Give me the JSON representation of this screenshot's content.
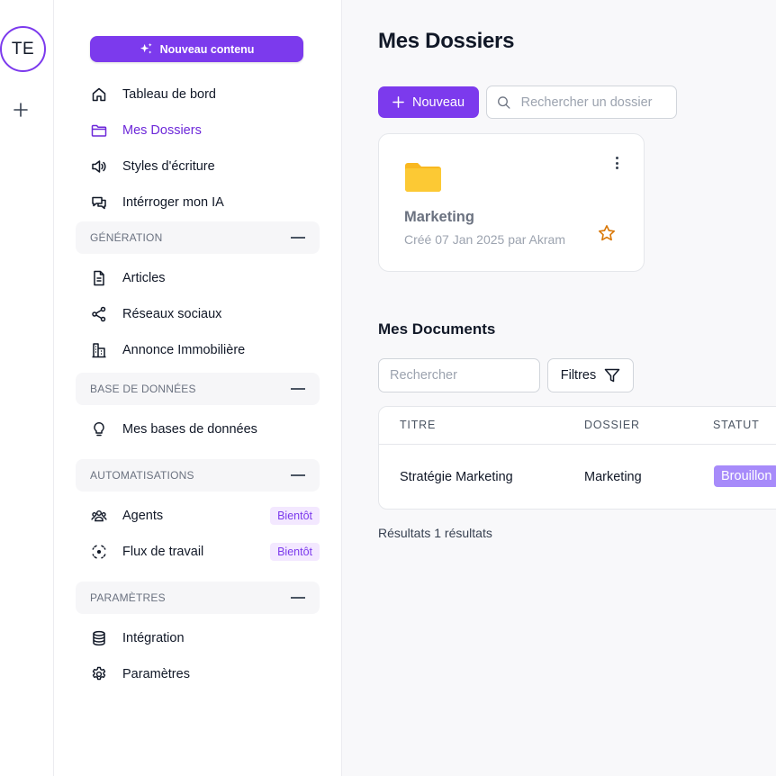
{
  "rail": {
    "avatar_initials": "TE"
  },
  "sidebar": {
    "new_content_label": "Nouveau contenu",
    "items": [
      {
        "label": "Tableau de bord",
        "icon": "home-icon"
      },
      {
        "label": "Mes Dossiers",
        "icon": "folder-icon",
        "active": true
      },
      {
        "label": "Styles d'écriture",
        "icon": "speaker-icon"
      },
      {
        "label": "Intérroger mon IA",
        "icon": "chat-icon"
      }
    ],
    "sections": {
      "generation": {
        "title": "Génération",
        "items": [
          {
            "label": "Articles",
            "icon": "document-icon"
          },
          {
            "label": "Réseaux sociaux",
            "icon": "share-icon"
          },
          {
            "label": "Annonce Immobilière",
            "icon": "building-icon"
          }
        ]
      },
      "database": {
        "title": "Base de données",
        "items": [
          {
            "label": "Mes bases de données",
            "icon": "lightbulb-icon"
          }
        ]
      },
      "automation": {
        "title": "Automatisations",
        "items": [
          {
            "label": "Agents",
            "icon": "users-icon",
            "badge": "Bientôt"
          },
          {
            "label": "Flux de travail",
            "icon": "workflow-icon",
            "badge": "Bientôt"
          }
        ]
      },
      "settings": {
        "title": "Paramètres",
        "items": [
          {
            "label": "Intégration",
            "icon": "database-icon"
          },
          {
            "label": "Paramètres",
            "icon": "gear-icon"
          }
        ]
      }
    }
  },
  "main": {
    "title": "Mes Dossiers",
    "new_button_label": "Nouveau",
    "folder_search_placeholder": "Rechercher un dossier",
    "folders": [
      {
        "name": "Marketing",
        "meta": "Créé 07 Jan 2025 par Akram"
      }
    ],
    "documents": {
      "title": "Mes Documents",
      "search_placeholder": "Rechercher",
      "filter_label": "Filtres",
      "columns": [
        "Titre",
        "Dossier",
        "Statut"
      ],
      "rows": [
        {
          "title": "Stratégie Marketing",
          "folder": "Marketing",
          "status": "Brouillon"
        }
      ],
      "results_text": "Résultats 1 résultats"
    }
  },
  "colors": {
    "accent": "#7c3aed",
    "folder": "#fbbf24",
    "star": "#d97706",
    "status_draft": "#a78bfa"
  }
}
